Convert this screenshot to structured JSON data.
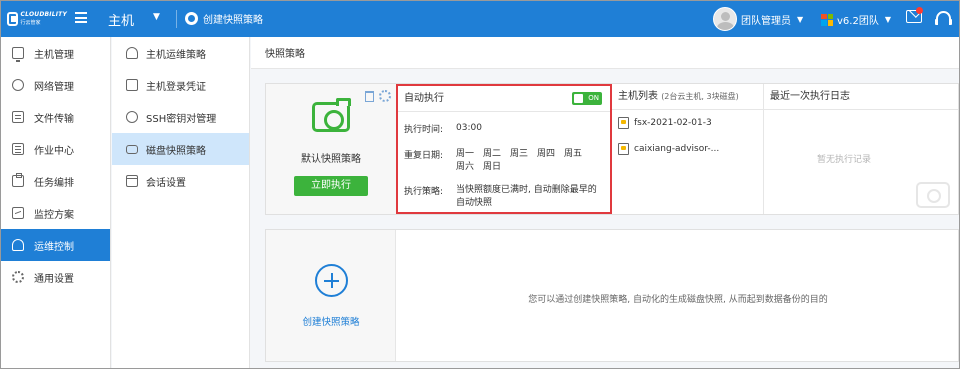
{
  "topbar": {
    "logo_text": "CLOUDBILITY",
    "logo_subtext": "行云管家",
    "menu_title": "主机",
    "create_label": "创建快照策略",
    "user_name": "团队管理员",
    "team_name": "v6.2团队"
  },
  "sidebar": {
    "items": [
      {
        "label": "主机管理",
        "icon": "monitor-icon"
      },
      {
        "label": "网络管理",
        "icon": "network-icon"
      },
      {
        "label": "文件传输",
        "icon": "file-transfer-icon"
      },
      {
        "label": "作业中心",
        "icon": "job-icon"
      },
      {
        "label": "任务编排",
        "icon": "task-icon"
      },
      {
        "label": "监控方案",
        "icon": "chart-icon"
      },
      {
        "label": "运维控制",
        "icon": "shield-icon",
        "active": true
      },
      {
        "label": "通用设置",
        "icon": "gear-icon"
      }
    ]
  },
  "subnav": {
    "items": [
      {
        "label": "主机运维策略"
      },
      {
        "label": "主机登录凭证"
      },
      {
        "label": "SSH密钥对管理"
      },
      {
        "label": "磁盘快照策略",
        "active": true
      },
      {
        "label": "会话设置"
      }
    ]
  },
  "main": {
    "page_title": "快照策略",
    "policy": {
      "name": "默认快照策略",
      "run_label": "立即执行"
    },
    "auto": {
      "title": "自动执行",
      "toggle": "ON",
      "time_label": "执行时间:",
      "time_value": "03:00",
      "days_label": "重复日期:",
      "days": [
        "周一",
        "周二",
        "周三",
        "周四",
        "周五",
        "周六",
        "周日"
      ],
      "strategy_label": "执行策略:",
      "strategy_value": "当快照额度已满时, 自动删除最早的自动快照"
    },
    "hosts": {
      "title": "主机列表",
      "note": "(2台云主机, 3块磁盘)",
      "items": [
        "fsx-2021-02-01-3",
        "caixiang-advisor-..."
      ]
    },
    "logs": {
      "title": "最近一次执行日志",
      "empty": "暂无执行记录"
    },
    "create": {
      "label": "创建快照策略",
      "description": "您可以通过创建快照策略, 自动化的生成磁盘快照, 从而起到数据备份的目的"
    }
  },
  "colors": {
    "primary": "#1f7fd6",
    "green": "#3cb33c",
    "highlight_border": "#e0393e"
  }
}
